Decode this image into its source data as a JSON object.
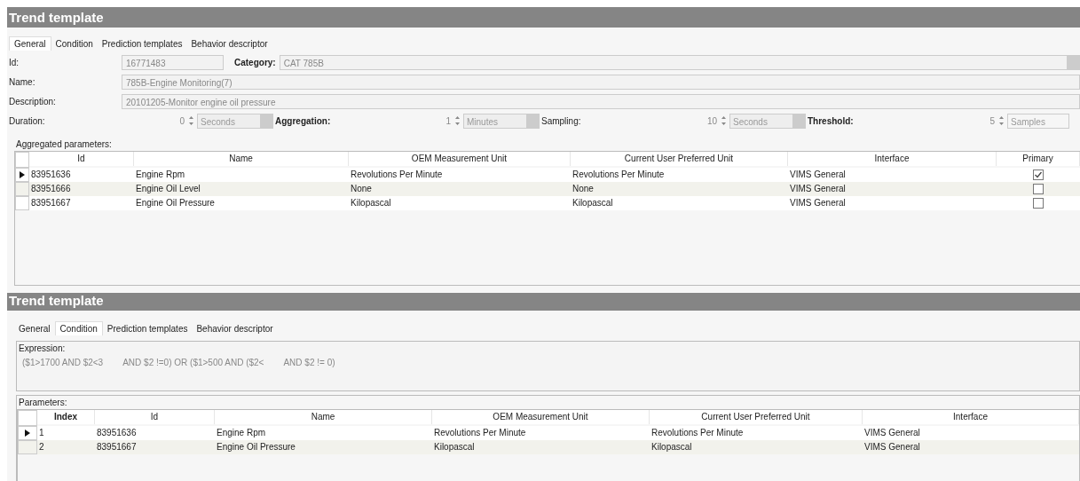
{
  "panels": [
    {
      "kind": "general",
      "title": "Trend template",
      "tabs": [
        {
          "label": "General",
          "selected": true
        },
        {
          "label": "Condition",
          "selected": false
        },
        {
          "label": "Prediction templates",
          "selected": false
        },
        {
          "label": "Behavior descriptor",
          "selected": false
        }
      ],
      "id": {
        "label": "Id:",
        "value": "16771483"
      },
      "category": {
        "label": "Category:",
        "value": "CAT 785B"
      },
      "name": {
        "label": "Name:",
        "value": "785B-Engine Monitoring(7)"
      },
      "description": {
        "label": "Description:",
        "value": "20101205-Monitor engine oil pressure"
      },
      "spinners": [
        {
          "label": "Duration:",
          "value": "0",
          "unit": "Seconds"
        },
        {
          "label": "Aggregation:",
          "value": "1",
          "unit": "Minutes"
        },
        {
          "label": "Sampling:",
          "value": "10",
          "unit": "Seconds"
        },
        {
          "label": "Threshold:",
          "value": "5",
          "unit": "Samples"
        }
      ],
      "table": {
        "label": "Aggregated parameters:",
        "columns": [
          "Id",
          "Name",
          "OEM Measurement Unit",
          "Current User Preferred Unit",
          "Interface",
          "Primary"
        ],
        "rows": [
          {
            "selected": true,
            "cells": [
              "83951636",
              "Engine Rpm",
              "Revolutions Per Minute",
              "Revolutions Per Minute",
              "VIMS General"
            ],
            "primary": true
          },
          {
            "selected": false,
            "cells": [
              "83951666",
              "Engine Oil Level",
              "None",
              "None",
              "VIMS General"
            ],
            "primary": false
          },
          {
            "selected": false,
            "cells": [
              "83951667",
              "Engine Oil Pressure",
              "Kilopascal",
              "Kilopascal",
              "VIMS General"
            ],
            "primary": false
          }
        ]
      }
    },
    {
      "kind": "condition",
      "title": "Trend template",
      "tabs": [
        {
          "label": "General",
          "selected": false
        },
        {
          "label": "Condition",
          "selected": true
        },
        {
          "label": "Prediction templates",
          "selected": false
        },
        {
          "label": "Behavior descriptor",
          "selected": false
        }
      ],
      "expression": {
        "label": "Expression:",
        "parts": [
          "($1>1700 AND $2<3",
          "AND $2 !=0) OR ($1>500 AND ($2<",
          "AND $2 != 0)"
        ]
      },
      "table": {
        "label": "Parameters:",
        "columns": [
          "Index",
          "Id",
          "Name",
          "OEM Measurement Unit",
          "Current User Preferred Unit",
          "Interface"
        ],
        "rows": [
          {
            "selected": true,
            "cells": [
              "1",
              "83951636",
              "Engine Rpm",
              "Revolutions Per Minute",
              "Revolutions Per Minute",
              "VIMS General"
            ]
          },
          {
            "selected": false,
            "cells": [
              "2",
              "83951667",
              "Engine Oil Pressure",
              "Kilopascal",
              "Kilopascal",
              "VIMS General"
            ]
          }
        ]
      }
    }
  ]
}
